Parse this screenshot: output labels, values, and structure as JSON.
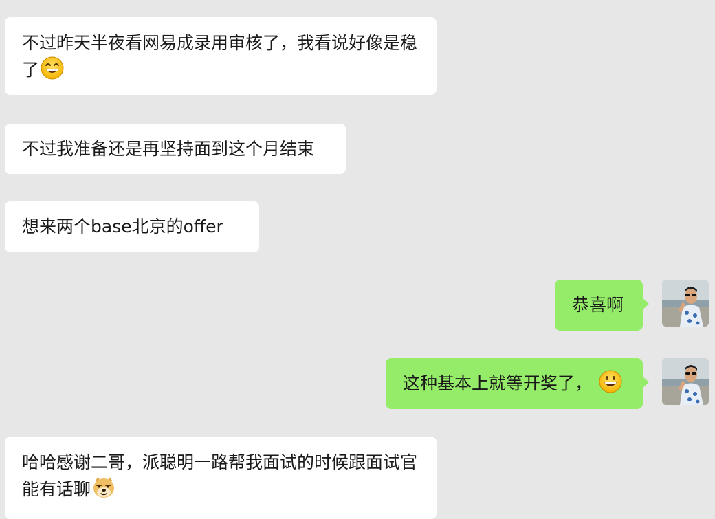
{
  "messages": [
    {
      "side": "in",
      "text": "不过昨天半夜看网易成录用审核了，我看说好像是稳了",
      "emoji": "grinning-face-with-smiling-eyes"
    },
    {
      "side": "in",
      "text": "不过我准备还是再坚持面到这个月结束"
    },
    {
      "side": "in",
      "text": "想来两个base北京的offer"
    },
    {
      "side": "out",
      "text": "恭喜啊"
    },
    {
      "side": "out",
      "text": "这种基本上就等开奖了，",
      "emoji": "grinning-face"
    },
    {
      "side": "in",
      "text": "哈哈感谢二哥，派聪明一路帮我面试的时候跟面试官能有话聊",
      "emoji": "doge"
    }
  ],
  "colors": {
    "background": "#e7e7e7",
    "incoming_bubble": "#ffffff",
    "outgoing_bubble": "#95ec69",
    "text": "#1a1a1a"
  },
  "icons": {
    "avatar": "user-avatar",
    "emoji_1": "grinning-face-with-smiling-eyes-icon",
    "emoji_2": "grinning-face-icon",
    "emoji_3": "doge-icon"
  }
}
